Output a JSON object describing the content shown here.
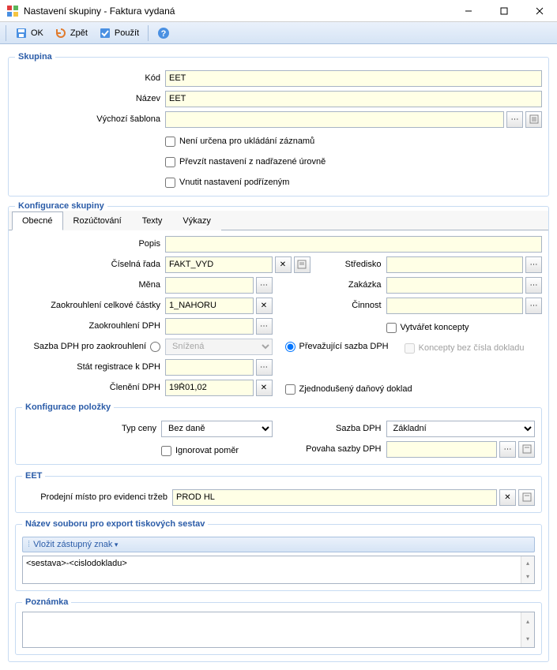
{
  "title": "Nastavení skupiny - Faktura vydaná",
  "toolbar": {
    "ok": "OK",
    "zpet": "Zpět",
    "pouzit": "Použít"
  },
  "skupina": {
    "legend": "Skupina",
    "kod_label": "Kód",
    "kod": "EET",
    "nazev_label": "Název",
    "nazev": "EET",
    "sablona_label": "Výchozí šablona",
    "sablona": "",
    "cb1": "Není určena pro ukládání záznamů",
    "cb2": "Převzít nastavení z nadřazené úrovně",
    "cb3": "Vnutit nastavení podřízeným"
  },
  "konfig": {
    "legend": "Konfigurace skupiny",
    "tabs": [
      "Obecné",
      "Rozúčtování",
      "Texty",
      "Výkazy"
    ],
    "popis_label": "Popis",
    "popis": "",
    "rada_label": "Číselná řada",
    "rada": "FAKT_VYD",
    "mena_label": "Měna",
    "mena": "",
    "zaok_celk_label": "Zaokrouhlení celkové částky",
    "zaok_celk": "1_NAHORU",
    "zaok_dph_label": "Zaokrouhlení DPH",
    "zaok_dph": "",
    "sazba_zaok_label": "Sazba DPH pro zaokrouhlení",
    "sazba_zaok": "Snížená",
    "stat_label": "Stát registrace k DPH",
    "stat": "",
    "cleneni_label": "Členění DPH",
    "cleneni": "19Ř01,02",
    "stredisko_label": "Středisko",
    "stredisko": "",
    "zakazka_label": "Zakázka",
    "zakazka": "",
    "cinnost_label": "Činnost",
    "cinnost": "",
    "vytv_konc": "Vytvářet koncepty",
    "konc_bez": "Koncepty bez čísla dokladu",
    "prev_sazba": "Převažující sazba DPH",
    "zjed": "Zjednodušený daňový doklad"
  },
  "polozka": {
    "legend": "Konfigurace položky",
    "typ_label": "Typ ceny",
    "typ": "Bez daně",
    "ignor": "Ignorovat poměr",
    "sazba_label": "Sazba DPH",
    "sazba": "Základní",
    "povaha_label": "Povaha sazby DPH",
    "povaha": ""
  },
  "eet": {
    "legend": "EET",
    "misto_label": "Prodejní místo pro evidenci tržeb",
    "misto": "PROD HL"
  },
  "export": {
    "legend": "Název souboru pro export tiskových sestav",
    "vlozit": "Vložit zástupný znak",
    "text": "<sestava>-<cislodokladu>"
  },
  "pozn": {
    "legend": "Poznámka",
    "text": ""
  }
}
